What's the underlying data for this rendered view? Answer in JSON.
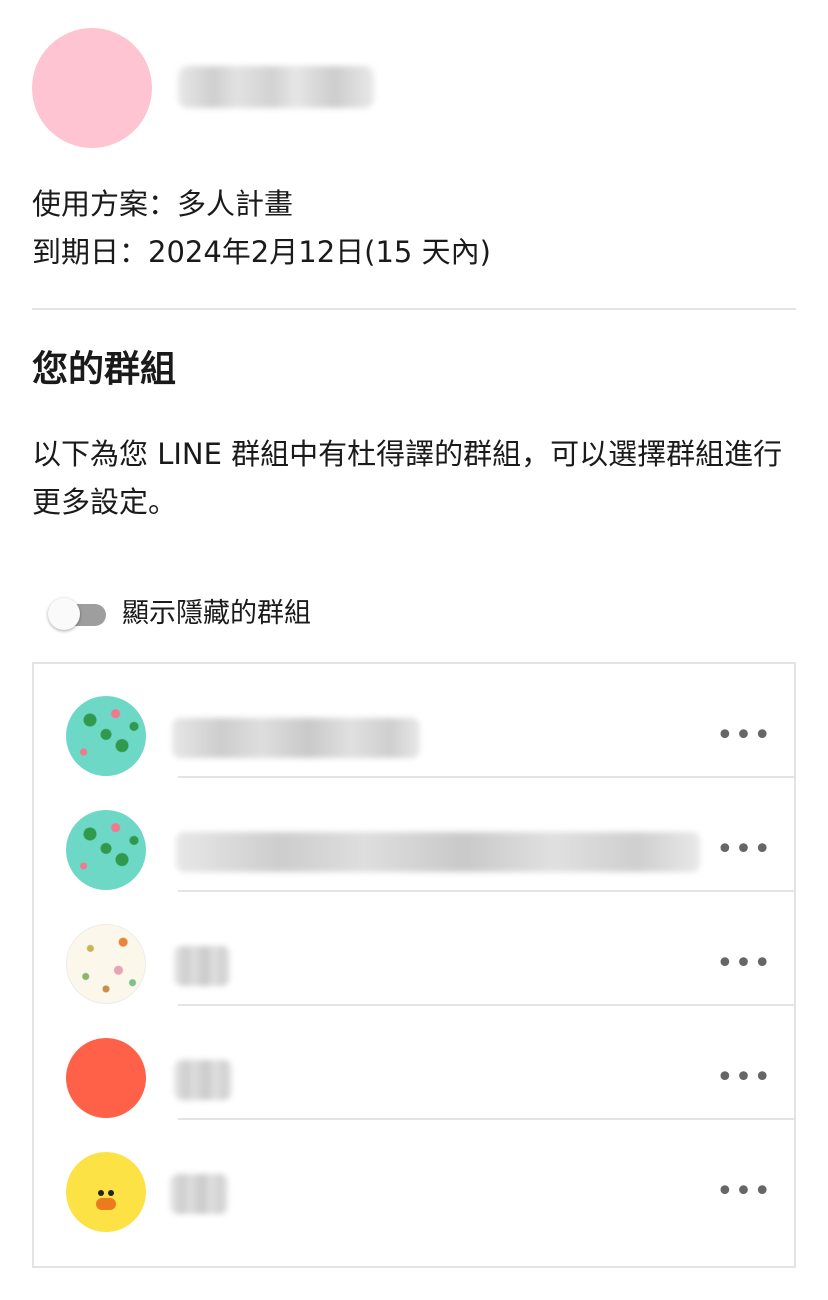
{
  "profile": {
    "avatar_color": "#ffc4d2",
    "name": ""
  },
  "plan": {
    "plan_text": "使用方案：多人計畫",
    "expiry_text": "到期日：2024年2月12日(15 天內)"
  },
  "groups_section": {
    "title": "您的群組",
    "description": "以下為您 LINE 群組中有杜得譯的群組，可以選擇群組進行更多設定。",
    "show_hidden_toggle": {
      "label": "顯示隱藏的群組",
      "checked": false
    },
    "groups": [
      {
        "avatar": "frog-pattern-avatar",
        "avatar_color": "#6ed8c6",
        "name": ""
      },
      {
        "avatar": "frog-pattern-avatar",
        "avatar_color": "#6ed8c6",
        "name": ""
      },
      {
        "avatar": "doodle-pattern-avatar",
        "avatar_color": "#fbf7ea",
        "name": ""
      },
      {
        "avatar": "red-avatar",
        "avatar_color": "#ff6048",
        "name": ""
      },
      {
        "avatar": "duck-avatar",
        "avatar_color": "#fde245",
        "name": ""
      }
    ],
    "more_label": "•••"
  }
}
